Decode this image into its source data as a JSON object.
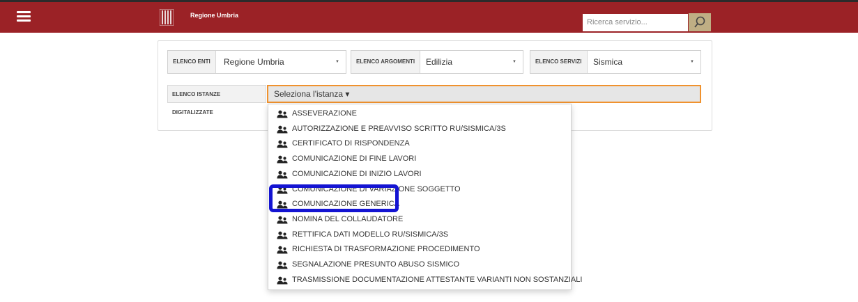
{
  "header": {
    "brand": "Regione Umbria",
    "search_placeholder": "Ricerca servizio...",
    "bar_color": "#9b2226"
  },
  "filters": {
    "enti": {
      "label": "ELENCO ENTI",
      "value": "Regione Umbria"
    },
    "argomenti": {
      "label": "ELENCO ARGOMENTI",
      "value": "Edilizia"
    },
    "servizi": {
      "label": "ELENCO SERVIZI",
      "value": "Sismica"
    },
    "istanze": {
      "label": "ELENCO ISTANZE DIGITALIZZATE",
      "value": "Seleziona l'istanza ▾"
    }
  },
  "dropdown": {
    "items": [
      "ASSEVERAZIONE",
      "AUTORIZZAZIONE E PREAVVISO SCRITTO RU/SISMICA/3S",
      "CERTIFICATO DI RISPONDENZA",
      "COMUNICAZIONE DI FINE LAVORI",
      "COMUNICAZIONE DI INIZIO LAVORI",
      "COMUNICAZIONE DI VARIAZIONE SOGGETTO",
      "COMUNICAZIONE GENERICA",
      "NOMINA DEL COLLAUDATORE",
      "RETTIFICA DATI MODELLO RU/SISMICA/3S",
      "RICHIESTA DI TRASFORMAZIONE PROCEDIMENTO",
      "SEGNALAZIONE PRESUNTO ABUSO SISMICO",
      "TRASMISSIONE DOCUMENTAZIONE ATTESTANTE VARIANTI NON SOSTANZIALI"
    ],
    "item_icon": "user-group-icon",
    "highlighted_item": "COMUNICAZIONE GENERICA",
    "highlight_color": "#1414d2"
  }
}
